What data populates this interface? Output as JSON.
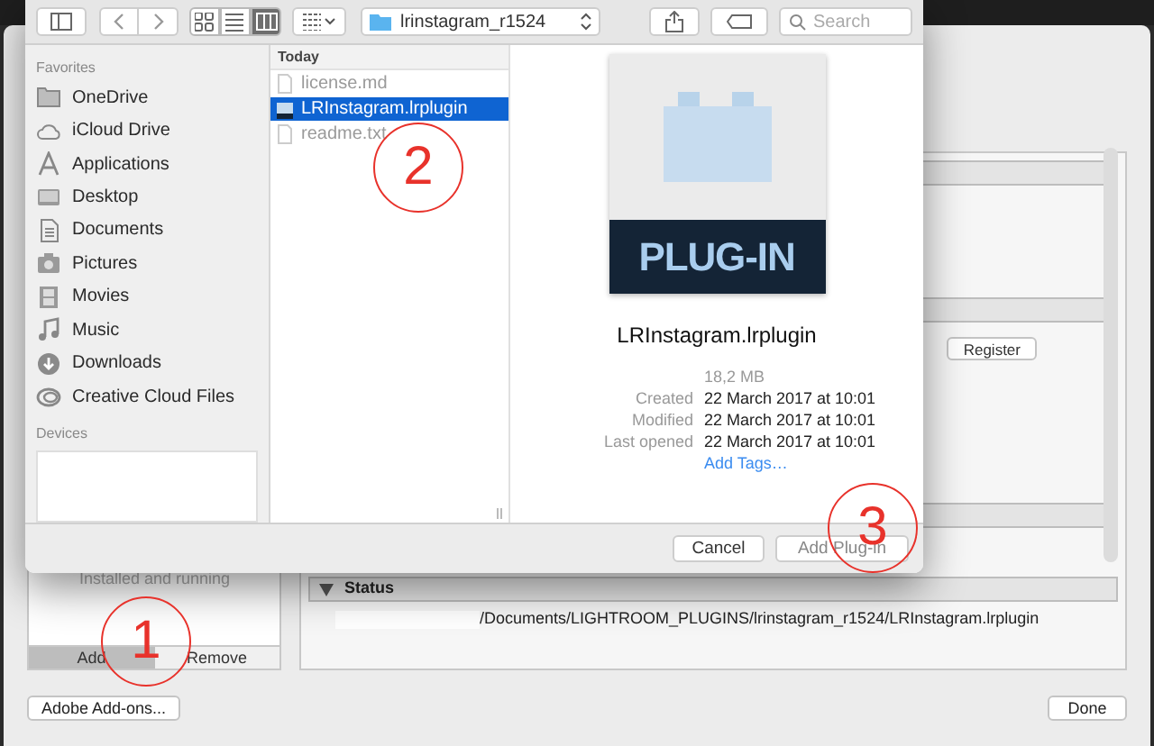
{
  "toolbar": {
    "view_modes": [
      {
        "kind": "icons",
        "selected": false
      },
      {
        "kind": "list",
        "selected": false
      },
      {
        "kind": "columns",
        "selected": true
      }
    ],
    "path": "lrinstagram_r1524",
    "search_placeholder": "Search"
  },
  "sidebar": {
    "favorites_heading": "Favorites",
    "favorites": [
      {
        "label": "OneDrive",
        "kind": "folder"
      },
      {
        "label": "iCloud Drive",
        "kind": "cloud"
      },
      {
        "label": "Applications",
        "kind": "apps"
      },
      {
        "label": "Desktop",
        "kind": "desktop"
      },
      {
        "label": "Documents",
        "kind": "documents"
      },
      {
        "label": "Pictures",
        "kind": "camera"
      },
      {
        "label": "Movies",
        "kind": "film"
      },
      {
        "label": "Music",
        "kind": "music"
      },
      {
        "label": "Downloads",
        "kind": "download"
      },
      {
        "label": "Creative Cloud Files",
        "kind": "creative"
      }
    ],
    "devices_heading": "Devices"
  },
  "column": {
    "heading": "Today",
    "files": [
      {
        "name": "license.md",
        "kind": "document",
        "selected": false
      },
      {
        "name": "LRInstagram.lrplugin",
        "kind": "plugin",
        "selected": true
      },
      {
        "name": "readme.txt",
        "kind": "document",
        "selected": false
      }
    ]
  },
  "preview": {
    "badge": "PLUG-IN",
    "name": "LRInstagram.lrplugin",
    "size": "18,2 MB",
    "details": [
      {
        "label": "Created",
        "value": "22 March 2017 at 10:01"
      },
      {
        "label": "Modified",
        "value": "22 March 2017 at 10:01"
      },
      {
        "label": "Last opened",
        "value": "22 March 2017 at 10:01"
      }
    ],
    "link": "Add Tags…"
  },
  "dialog_buttons": [
    {
      "label": "Cancel"
    },
    {
      "label": "Add Plug-in"
    }
  ],
  "manager": {
    "list_item": "Installed and running",
    "list_buttons": [
      {
        "label": "Add",
        "selected": true
      },
      {
        "label": "Remove",
        "selected": false
      }
    ],
    "register": "Register",
    "status_heading": "Status",
    "path": "/Documents/LIGHTROOM_PLUGINS/lrinstagram_r1524/LRInstagram.lrplugin",
    "footer_buttons": [
      "Adobe Add-ons...",
      "Done"
    ]
  },
  "annotations": [
    "1",
    "2",
    "3"
  ]
}
